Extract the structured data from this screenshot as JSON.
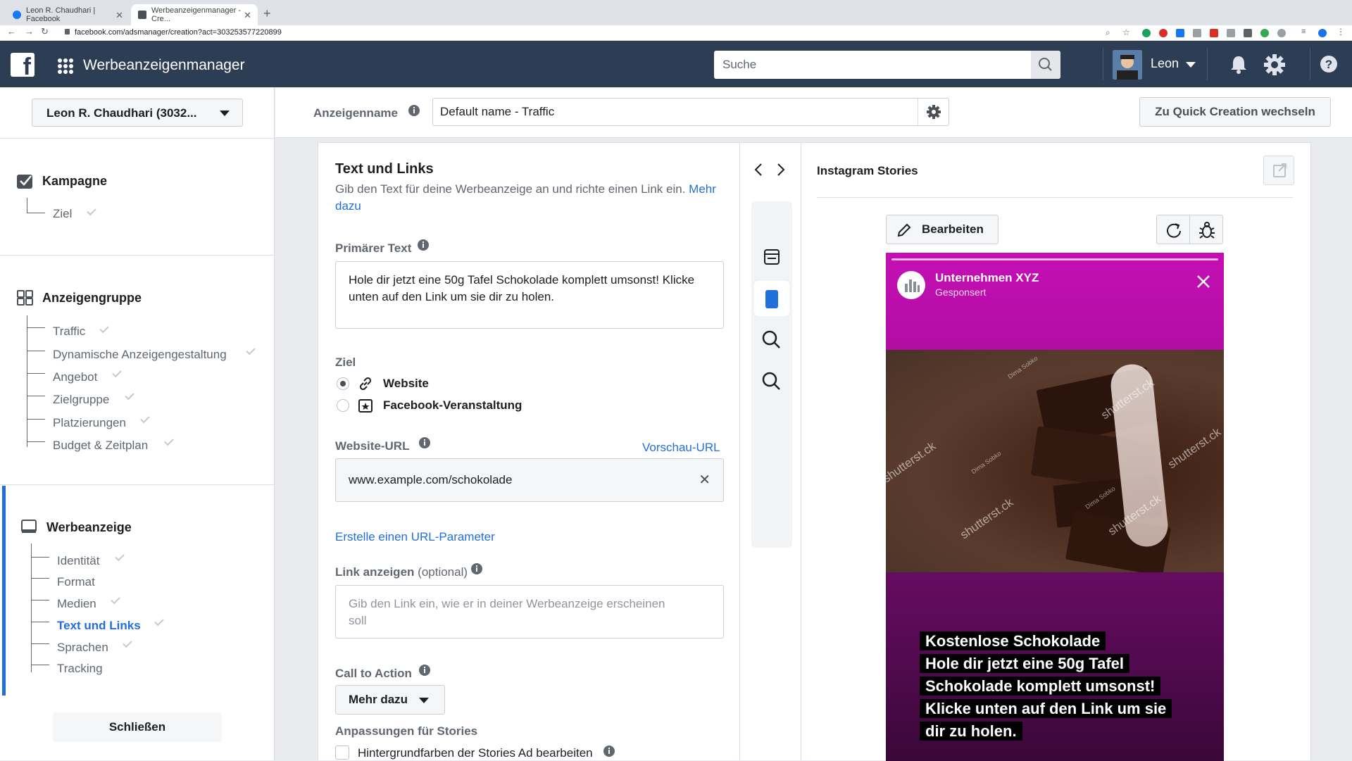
{
  "browser": {
    "tabs": [
      {
        "title": "Leon R. Chaudhari | Facebook"
      },
      {
        "title": "Werbeanzeigenmanager - Cre..."
      }
    ],
    "url": "facebook.com/adsmanager/creation?act=303253577220899"
  },
  "header": {
    "app_title": "Werbeanzeigenmanager",
    "search_placeholder": "Suche",
    "user_name": "Leon"
  },
  "sidebar": {
    "account_label": "Leon R. Chaudhari (3032...",
    "sections": [
      {
        "title": "Kampagne",
        "items": [
          {
            "label": "Ziel",
            "done": true
          }
        ]
      },
      {
        "title": "Anzeigengruppe",
        "items": [
          {
            "label": "Traffic",
            "done": true
          },
          {
            "label": "Dynamische Anzeigengestaltung",
            "done": true
          },
          {
            "label": "Angebot",
            "done": true
          },
          {
            "label": "Zielgruppe",
            "done": true
          },
          {
            "label": "Platzierungen",
            "done": true
          },
          {
            "label": "Budget & Zeitplan",
            "done": true
          }
        ]
      },
      {
        "title": "Werbeanzeige",
        "items": [
          {
            "label": "Identität",
            "done": true
          },
          {
            "label": "Format",
            "done": false
          },
          {
            "label": "Medien",
            "done": true
          },
          {
            "label": "Text und Links",
            "done": true,
            "active": true
          },
          {
            "label": "Sprachen",
            "done": true
          },
          {
            "label": "Tracking",
            "done": false
          }
        ]
      }
    ],
    "close_label": "Schließen"
  },
  "topbar": {
    "ad_name_label": "Anzeigenname",
    "ad_name_value": "Default name - Traffic",
    "quick_creation_label": "Zu Quick Creation wechseln"
  },
  "form": {
    "title": "Text und Links",
    "description": "Gib den Text für deine Werbeanzeige an und richte einen Link ein.",
    "more_link": "Mehr dazu",
    "primary_text_label": "Primärer Text",
    "primary_text_value": "Hole dir jetzt eine 50g Tafel Schokolade komplett umsonst! Klicke unten auf den Link um sie dir zu holen.",
    "goal_label": "Ziel",
    "goal_options": [
      {
        "label": "Website",
        "selected": true
      },
      {
        "label": "Facebook-Veranstaltung",
        "selected": false
      }
    ],
    "website_url_label": "Website-URL",
    "preview_url_link": "Vorschau-URL",
    "website_url_value": "www.example.com/schokolade",
    "url_param_link": "Erstelle einen URL-Parameter",
    "display_link_label": "Link anzeigen",
    "display_link_optional": "(optional)",
    "display_link_placeholder": "Gib den Link ein, wie er in deiner Werbeanzeige erscheinen soll",
    "cta_label": "Call to Action",
    "cta_value": "Mehr dazu",
    "stories_label": "Anpassungen für Stories",
    "stories_checkbox_label": "Hintergrundfarben der Stories Ad bearbeiten"
  },
  "preview": {
    "title": "Instagram Stories",
    "edit_label": "Bearbeiten",
    "story": {
      "account": "Unternehmen XYZ",
      "sponsored": "Gesponsert",
      "watermark": "shutterst.ck",
      "watermark_small": "Dima Sobko",
      "overlay_lines": [
        "Kostenlose Schokolade",
        "Hole dir jetzt eine 50g Tafel",
        "Schokolade komplett umsonst!",
        "Klicke unten auf den Link um sie",
        "dir zu holen."
      ]
    }
  },
  "colors": {
    "header_bg": "#2d3d53",
    "accent": "#216fdb",
    "story_magenta": "#c50fb4"
  }
}
